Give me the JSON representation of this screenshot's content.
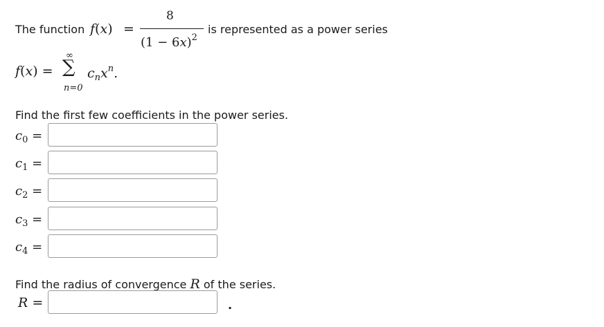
{
  "intro": {
    "prefix": "The function",
    "func": "f",
    "var": "x",
    "equals": "=",
    "numerator": "8",
    "denominator_base": "(1 − 6",
    "denominator_var": "x",
    "denominator_close": ")",
    "denominator_exp": "2",
    "suffix": "is represented as a power series"
  },
  "series": {
    "lhs": "f(x) =",
    "sigma": "∑",
    "upper": "∞",
    "lower": "n=0",
    "term_c": "c",
    "term_sub": "n",
    "term_x": "x",
    "term_exp": "n",
    "period": "."
  },
  "coefficients_prompt": "Find the first few coefficients in the power series.",
  "coefficients": [
    {
      "name": "c",
      "sub": "0",
      "eq": "=",
      "value": ""
    },
    {
      "name": "c",
      "sub": "1",
      "eq": "=",
      "value": ""
    },
    {
      "name": "c",
      "sub": "2",
      "eq": "=",
      "value": ""
    },
    {
      "name": "c",
      "sub": "3",
      "eq": "=",
      "value": ""
    },
    {
      "name": "c",
      "sub": "4",
      "eq": "=",
      "value": ""
    }
  ],
  "radius_prompt_before": "Find the radius of convergence",
  "radius_symbol": "R",
  "radius_prompt_after": "of the series.",
  "radius_label": "R",
  "radius_eq": "=",
  "radius_value": "",
  "radius_period": "."
}
